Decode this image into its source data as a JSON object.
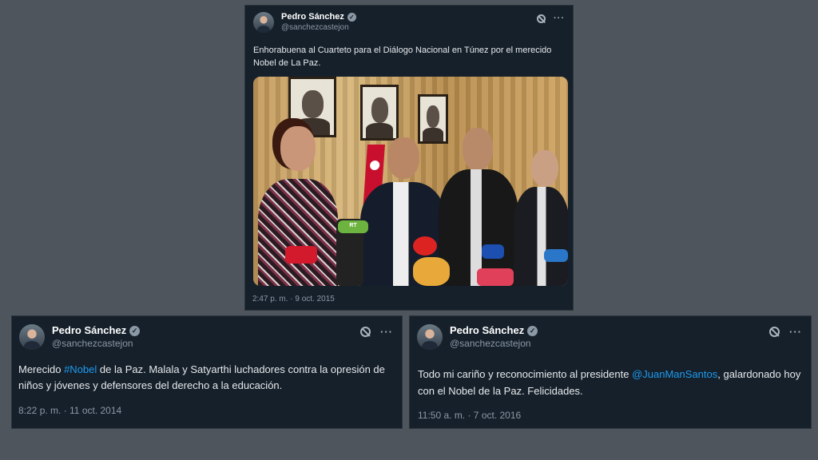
{
  "tweets": {
    "top": {
      "display_name": "Pedro Sánchez",
      "handle": "@sanchezcastejon",
      "text": "Enhorabuena al Cuarteto para el Diálogo Nacional en Túnez por el merecido Nobel de La Paz.",
      "timestamp": "2:47 p. m. · 9 oct. 2015",
      "mics": [
        "RT",
        "",
        ""
      ]
    },
    "left": {
      "display_name": "Pedro Sánchez",
      "handle": "@sanchezcastejon",
      "text_before": "Merecido ",
      "hashtag": "#Nobel",
      "text_after": " de la Paz. Malala y Satyarthi luchadores contra la opresión de niños y jóvenes y defensores del derecho a la educación.",
      "timestamp": "8:22 p. m. · 11 oct. 2014"
    },
    "right": {
      "display_name": "Pedro Sánchez",
      "handle": "@sanchezcastejon",
      "text_before": "Todo mi cariño y reconocimiento al presidente ",
      "mention": "@JuanManSantos",
      "text_after": ", galardonado hoy con el Nobel de la Paz. Felicidades.",
      "timestamp": "11:50 a. m. · 7 oct. 2016"
    }
  },
  "icons": {
    "verified": "verified-badge-icon",
    "grok": "grok-icon",
    "more": "more-icon"
  },
  "colors": {
    "page_bg": "#4f555c",
    "card_bg": "#15202b",
    "link": "#1d9bf0",
    "muted": "#8b98a5"
  }
}
